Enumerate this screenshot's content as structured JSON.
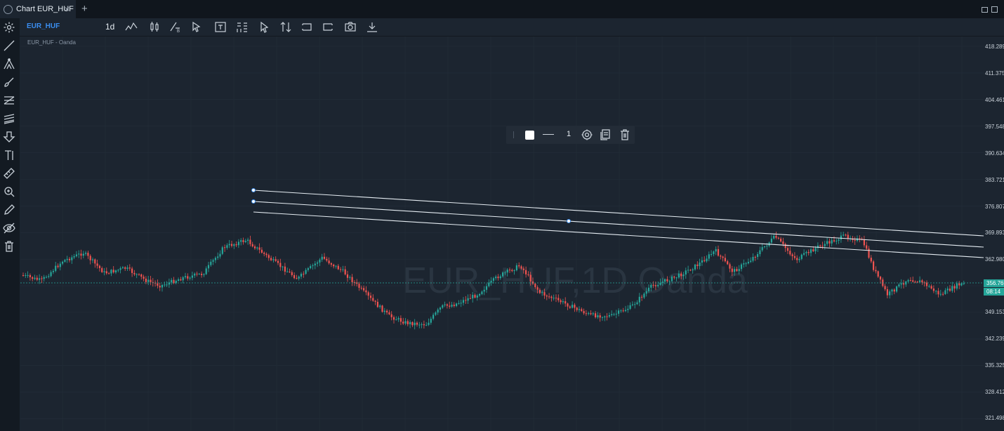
{
  "tab": {
    "title": "Chart EUR_HUF",
    "close": "×",
    "add": "+"
  },
  "toolbar": {
    "symbol": "EUR_HUF",
    "timeframe": "1d"
  },
  "chart": {
    "subtitle": "EUR_HUF - Oanda",
    "watermark": "EUR_HUF,1D Oanda",
    "price_axis": [
      "418.289",
      "411.3754",
      "404.461",
      "397.548",
      "390.634",
      "383.721",
      "376.807",
      "369.893",
      "362.980",
      "349.1534",
      "342.239",
      "335.325",
      "328.412",
      "321.498"
    ],
    "last_price": "356.766",
    "countdown": "08:14",
    "colors": {
      "up": "#26a69a",
      "down": "#ef5350",
      "background": "#1c2530",
      "grid": "#232e3a"
    }
  },
  "drawing_toolbar": {
    "line_width": "1",
    "color": "#ffffff"
  },
  "icons": {
    "top_toolbar": [
      "indicators-icon",
      "chart-type-icon",
      "compare-icon",
      "cursor-icon",
      "text-icon",
      "layout-icon",
      "pointer-icon",
      "sort-icon",
      "undo-icon",
      "redo-icon",
      "camera-icon",
      "download-icon"
    ],
    "sidebar": [
      "settings-icon",
      "trend-line-icon",
      "pitchfork-icon",
      "brush-icon",
      "fibonacci-icon",
      "gann-icon",
      "arrow-down-icon",
      "text-tool-icon",
      "ruler-icon",
      "zoom-in-icon",
      "pencil-icon",
      "eye-off-icon",
      "trash-icon"
    ],
    "drawing_toolbar": [
      "gear-icon",
      "clone-icon",
      "trash-icon"
    ]
  }
}
